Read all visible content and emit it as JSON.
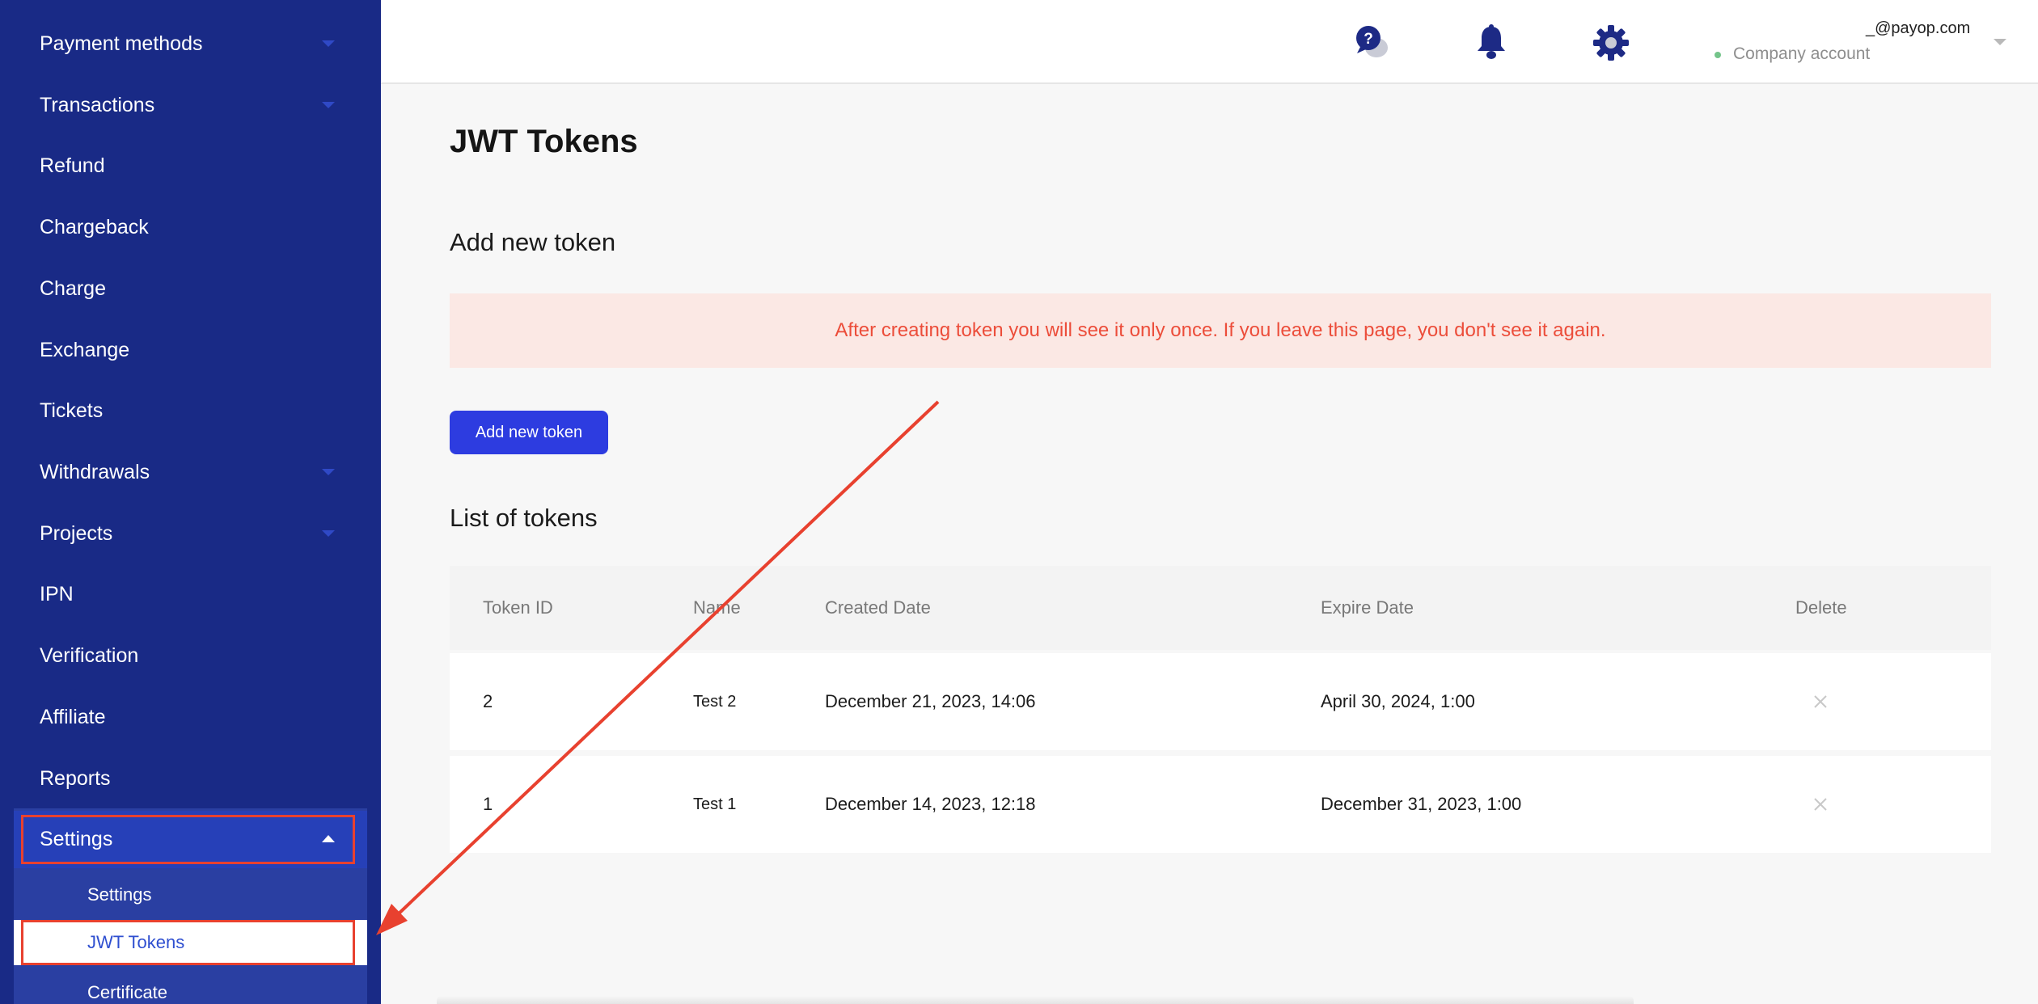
{
  "sidebar": {
    "items": [
      {
        "label": "Payment methods",
        "has_dropdown": true
      },
      {
        "label": "Transactions",
        "has_dropdown": true
      },
      {
        "label": "Refund",
        "has_dropdown": false
      },
      {
        "label": "Chargeback",
        "has_dropdown": false
      },
      {
        "label": "Charge",
        "has_dropdown": false
      },
      {
        "label": "Exchange",
        "has_dropdown": false
      },
      {
        "label": "Tickets",
        "has_dropdown": false
      },
      {
        "label": "Withdrawals",
        "has_dropdown": true
      },
      {
        "label": "Projects",
        "has_dropdown": true
      },
      {
        "label": "IPN",
        "has_dropdown": false
      },
      {
        "label": "Verification",
        "has_dropdown": false
      },
      {
        "label": "Affiliate",
        "has_dropdown": false
      },
      {
        "label": "Reports",
        "has_dropdown": false
      }
    ],
    "settings": {
      "label": "Settings",
      "expanded": true,
      "subitems": [
        {
          "label": "Settings",
          "active": false
        },
        {
          "label": "JWT Tokens",
          "active": true
        },
        {
          "label": "Certificate",
          "active": false
        }
      ]
    }
  },
  "topbar": {
    "icons": [
      "help-chat-icon",
      "bell-icon",
      "gear-icon"
    ],
    "account": {
      "email": "_@payop.com",
      "type": "Company account"
    }
  },
  "main": {
    "title": "JWT Tokens",
    "add_section": {
      "title": "Add new token",
      "warning": "After creating token you will see it only once. If you leave this page, you don't see it again.",
      "button_label": "Add new token"
    },
    "list_section": {
      "title": "List of tokens",
      "columns": [
        "Token ID",
        "Name",
        "Created Date",
        "Expire Date",
        "Delete"
      ],
      "rows": [
        {
          "id": "2",
          "name": "Test 2",
          "created": "December 21, 2023, 14:06",
          "expire": "April 30, 2024, 1:00"
        },
        {
          "id": "1",
          "name": "Test 1",
          "created": "December 14, 2023, 12:18",
          "expire": "December 31, 2023, 1:00"
        }
      ]
    }
  },
  "colors": {
    "sidebar_bg": "#192a86",
    "accent": "#2d3ce0",
    "warning_text": "#ec4d3a",
    "warning_bg": "#fbe8e4",
    "annotation": "#e8412f"
  }
}
